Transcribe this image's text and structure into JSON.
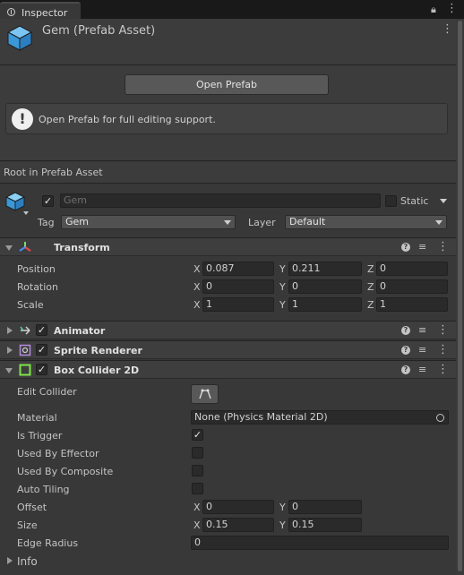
{
  "tab": {
    "title": "Inspector"
  },
  "asset": {
    "title": "Gem (Prefab Asset)"
  },
  "open_prefab": {
    "label": "Open Prefab"
  },
  "help": {
    "text": "Open Prefab for full editing support.",
    "icon": "!"
  },
  "root_label": "Root in Prefab Asset",
  "gameobject": {
    "name_placeholder": "Gem",
    "active": true,
    "static_label": "Static",
    "tag_label": "Tag",
    "tag_value": "Gem",
    "layer_label": "Layer",
    "layer_value": "Default"
  },
  "transform": {
    "title": "Transform",
    "position": {
      "label": "Position",
      "x": "0.087",
      "y": "0.211",
      "z": "0"
    },
    "rotation": {
      "label": "Rotation",
      "x": "0",
      "y": "0",
      "z": "0"
    },
    "scale": {
      "label": "Scale",
      "x": "1",
      "y": "1",
      "z": "1"
    },
    "axes": {
      "x": "X",
      "y": "Y",
      "z": "Z"
    }
  },
  "animator": {
    "title": "Animator",
    "enabled": true
  },
  "sprite_renderer": {
    "title": "Sprite Renderer",
    "enabled": true
  },
  "box_collider": {
    "title": "Box Collider 2D",
    "enabled": true,
    "edit_collider_label": "Edit Collider",
    "material_label": "Material",
    "material_value": "None (Physics Material 2D)",
    "is_trigger_label": "Is Trigger",
    "is_trigger": true,
    "used_by_effector_label": "Used By Effector",
    "used_by_composite_label": "Used By Composite",
    "auto_tiling_label": "Auto Tiling",
    "offset_label": "Offset",
    "offset": {
      "x": "0",
      "y": "0"
    },
    "size_label": "Size",
    "size": {
      "x": "0.15",
      "y": "0.15"
    },
    "edge_radius_label": "Edge Radius",
    "edge_radius": "0"
  },
  "info": {
    "label": "Info"
  },
  "icons": {
    "help": "?",
    "check": "✓"
  },
  "colors": {
    "background": "#383838",
    "header": "#3c3c3c",
    "field": "#2a2a2a",
    "transform_x": "#ef4848",
    "transform_y": "#7dd96b",
    "transform_z": "#4c8cf2",
    "cube": "#4aa8e8",
    "collider": "#7ee44a"
  }
}
